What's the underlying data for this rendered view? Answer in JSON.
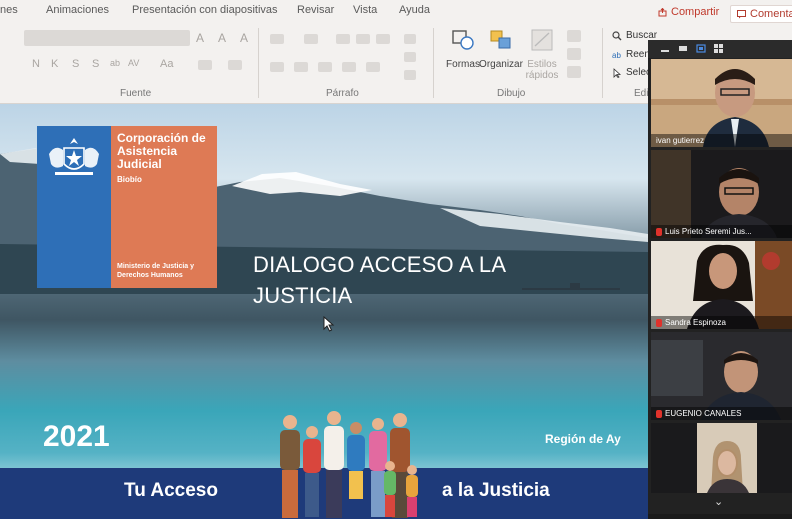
{
  "ribbon": {
    "tabs": [
      "nes",
      "Animaciones",
      "Presentación con diapositivas",
      "Revisar",
      "Vista",
      "Ayuda"
    ],
    "share_label": "Compartir",
    "comments_label": "Comentarios",
    "groups": {
      "font": "Fuente",
      "paragraph": "Párrafo",
      "drawing": "Dibujo",
      "editing": "Edic"
    },
    "drawing_buttons": {
      "shapes": "Formas",
      "arrange": "Organizar",
      "quick_styles": "Estilos rápidos"
    },
    "edit_items": {
      "find": "Buscar",
      "replace": "Reemp",
      "select": "Selecc"
    },
    "font_glyphs": [
      "N",
      "K",
      "S",
      "S",
      "ab",
      "AV",
      "Aa"
    ]
  },
  "slide": {
    "logo": {
      "title": "Corporación de Asistencia Judicial",
      "region": "Biobío",
      "ministry": "Ministerio de Justicia y Derechos Humanos"
    },
    "title_line1": "DIALOGO ACCESO A LA",
    "title_line2": "JUSTICIA",
    "year": "2021",
    "region_text": "Región de Ay",
    "tagline_left": "Tu Acceso",
    "tagline_right": "a la Justicia"
  },
  "participants": [
    {
      "name": "ivan gutierrez",
      "muted": false
    },
    {
      "name": "Luis Prieto Seremi Jus...",
      "muted": true
    },
    {
      "name": "Sandra Espinoza",
      "muted": true
    },
    {
      "name": "EUGENIO CANALES",
      "muted": true
    },
    {
      "name": "",
      "muted": false
    }
  ],
  "colors": {
    "logo_blue": "#2e6fb7",
    "logo_orange": "#de7a55",
    "bottom_bar": "#1e3a7a",
    "mic_muted": "#e0322b",
    "share_red": "#c0392b"
  }
}
